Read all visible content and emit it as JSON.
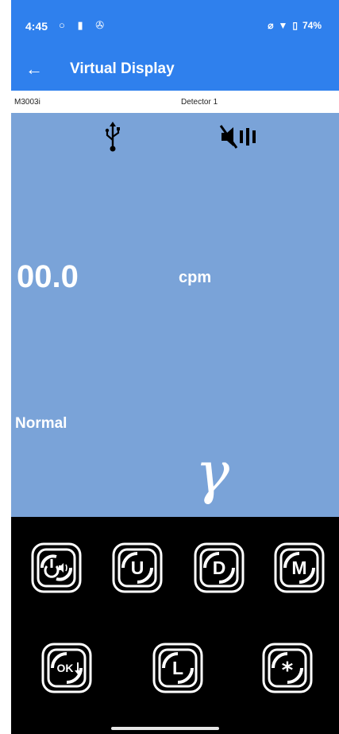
{
  "status_bar": {
    "time": "4:45",
    "battery": "74%"
  },
  "app_bar": {
    "title": "Virtual Display"
  },
  "info_row": {
    "model": "M3003i",
    "detector": "Detector 1"
  },
  "display": {
    "reading": "00.0",
    "unit": "cpm",
    "status": "Normal",
    "radiation_symbol": "γ"
  },
  "keypad": {
    "row1": [
      {
        "icon": "power-speaker-icon"
      },
      {
        "label": "U",
        "icon": "up-cycle-icon"
      },
      {
        "label": "D",
        "icon": "down-cycle-icon"
      },
      {
        "label": "M",
        "icon": "mode-cycle-icon"
      }
    ],
    "row2": [
      {
        "label": "OK",
        "icon": "ok-cycle-icon"
      },
      {
        "label": "L",
        "icon": "light-cycle-icon"
      },
      {
        "label": "*",
        "icon": "star-cycle-icon"
      }
    ]
  }
}
